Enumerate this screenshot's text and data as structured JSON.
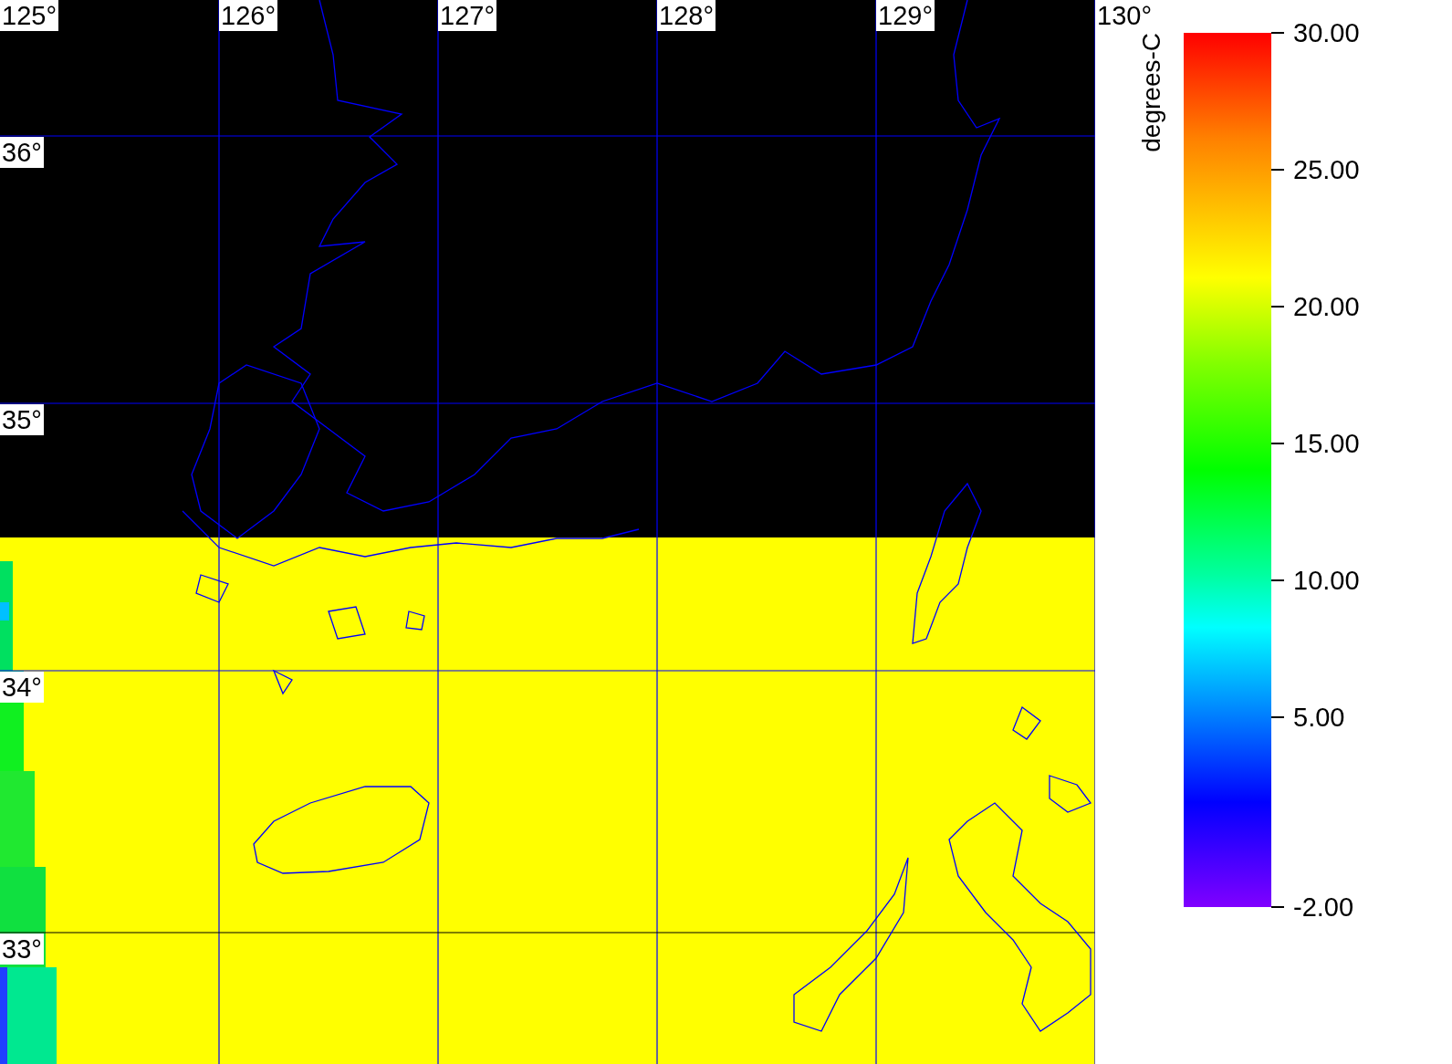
{
  "map": {
    "lon_labels": [
      "125°",
      "126°",
      "127°",
      "128°",
      "129°",
      "130°"
    ],
    "lat_labels": [
      "36°",
      "35°",
      "34°",
      "33°"
    ]
  },
  "colorbar": {
    "unit": "degrees-C",
    "ticks": [
      "30.00",
      "25.00",
      "20.00",
      "15.00",
      "10.00",
      "5.00",
      "-2.00"
    ]
  }
}
